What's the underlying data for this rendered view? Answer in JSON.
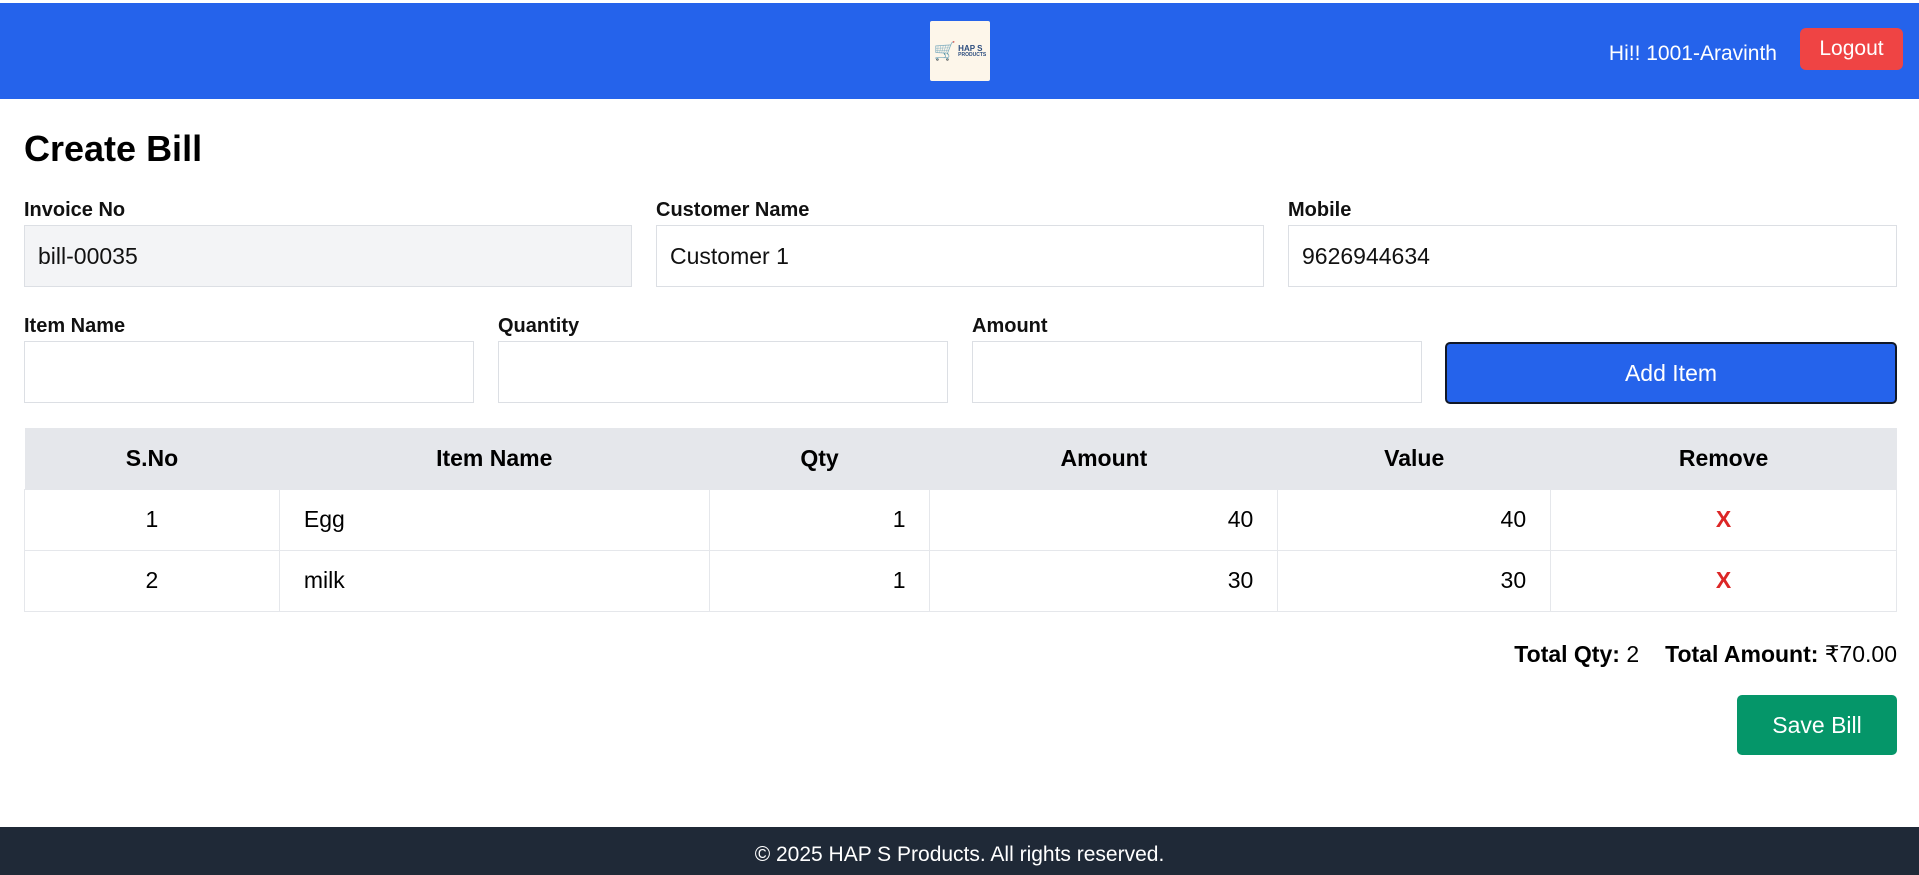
{
  "header": {
    "logo_text_line1": "HAP S",
    "logo_text_line2": "PRODUCTS",
    "greeting": "Hi!! 1001-Aravinth",
    "logout_label": "Logout"
  },
  "page_title": "Create Bill",
  "form": {
    "invoice_label": "Invoice No",
    "invoice_value": "bill-00035",
    "customer_label": "Customer Name",
    "customer_value": "Customer 1",
    "mobile_label": "Mobile",
    "mobile_value": "9626944634",
    "item_name_label": "Item Name",
    "item_name_value": "",
    "quantity_label": "Quantity",
    "quantity_value": "",
    "amount_label": "Amount",
    "amount_value": "",
    "add_item_label": "Add Item"
  },
  "table": {
    "headers": [
      "S.No",
      "Item Name",
      "Qty",
      "Amount",
      "Value",
      "Remove"
    ],
    "rows": [
      {
        "sno": "1",
        "name": "Egg",
        "qty": "1",
        "amount": "40",
        "value": "40",
        "remove": "X"
      },
      {
        "sno": "2",
        "name": "milk",
        "qty": "1",
        "amount": "30",
        "value": "30",
        "remove": "X"
      }
    ]
  },
  "totals": {
    "qty_label": "Total Qty:",
    "qty_value": "2",
    "amount_label": "Total Amount:",
    "amount_value": "₹70.00"
  },
  "save_label": "Save Bill",
  "footer": "© 2025 HAP S Products. All rights reserved.",
  "colors": {
    "navbar": "#2563eb",
    "logout": "#ef4444",
    "add_button": "#2563eb",
    "save_button": "#059669",
    "remove": "#dc2626",
    "footer": "#1f2937"
  }
}
